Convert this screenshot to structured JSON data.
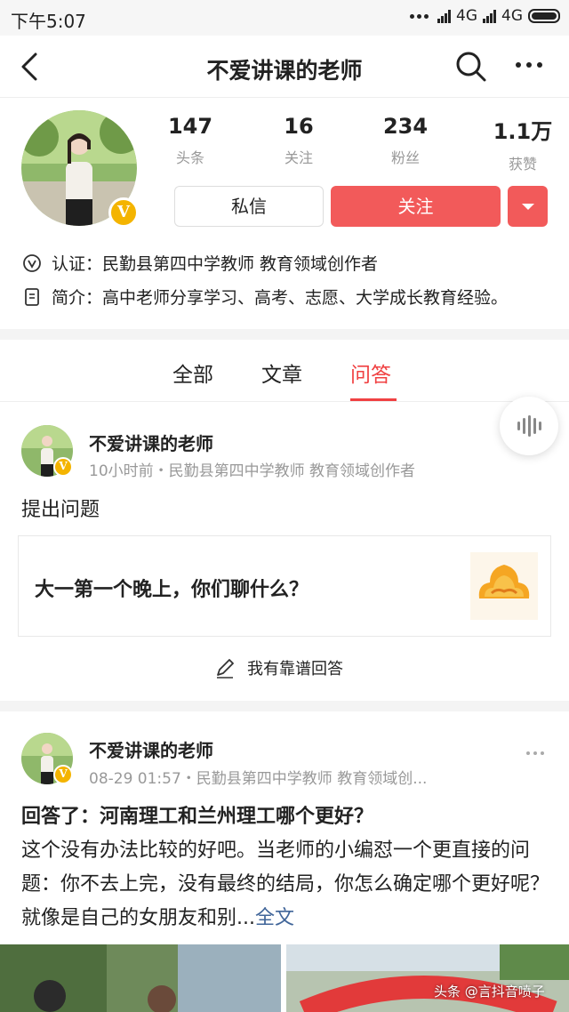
{
  "status_bar": {
    "time": "下午5:07",
    "network_1": "4G",
    "network_2": "4G"
  },
  "nav": {
    "title": "不爱讲课的老师",
    "icons": [
      "back-arrow-icon",
      "search-icon",
      "more-icon"
    ]
  },
  "profile": {
    "verified_badge": "V",
    "stats": [
      {
        "value": "147",
        "label": "头条"
      },
      {
        "value": "16",
        "label": "关注"
      },
      {
        "value": "234",
        "label": "粉丝"
      },
      {
        "value": "1.1万",
        "label": "获赞"
      }
    ],
    "message_button": "私信",
    "follow_button": "关注",
    "certification": "认证：民勤县第四中学教师 教育领域创作者",
    "intro": "简介：高中老师分享学习、高考、志愿、大学成长教育经验。"
  },
  "tabs": [
    {
      "label": "全部",
      "active": false
    },
    {
      "label": "文章",
      "active": false
    },
    {
      "label": "问答",
      "active": true
    }
  ],
  "feed": [
    {
      "author": "不爱讲课的老师",
      "meta": "10小时前・民勤县第四中学教师 教育领域创作者",
      "type": "提出问题",
      "question": "大一第一个晚上，你们聊什么？",
      "answer_prompt": "我有靠谱回答"
    },
    {
      "author": "不爱讲课的老师",
      "meta": "08-29 01:57・民勤县第四中学教师 教育领域创...",
      "title": "回答了：河南理工和兰州理工哪个更好？",
      "body": "这个没有办法比较的好吧。当老师的小编怼一个更直接的问题：你不去上完，没有最终的结局，你怎么确定哪个更好呢？就像是自己的女朋友和别...",
      "full_text_link": "全文"
    }
  ],
  "watermark": "头条 @言抖音喷子",
  "colors": {
    "accent_red": "#f04142",
    "follow_button": "#f25a5a",
    "muted_text": "#999999",
    "link_blue": "#406599",
    "badge_gold": "#f4b400"
  }
}
